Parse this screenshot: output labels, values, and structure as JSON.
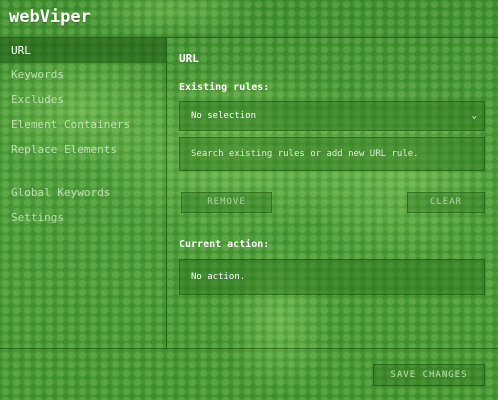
{
  "app": {
    "title": "webViper"
  },
  "sidebar": {
    "items": [
      {
        "label": "URL",
        "active": true
      },
      {
        "label": "Keywords"
      },
      {
        "label": "Excludes"
      },
      {
        "label": "Element Containers"
      },
      {
        "label": "Replace Elements"
      },
      {
        "label": "Global Keywords"
      },
      {
        "label": "Settings"
      }
    ]
  },
  "main": {
    "title": "URL",
    "existing_rules_label": "Existing rules:",
    "rules_select_value": "No selection",
    "rule_input_placeholder": "Search existing rules or add new URL rule.",
    "remove_label": "REMOVE",
    "clear_label": "CLEAR",
    "current_action_label": "Current action:",
    "current_action_value": "No action."
  },
  "footer": {
    "save_label": "SAVE CHANGES"
  },
  "theme": {
    "background": "#4a9a3a",
    "text": "#ffffff"
  }
}
